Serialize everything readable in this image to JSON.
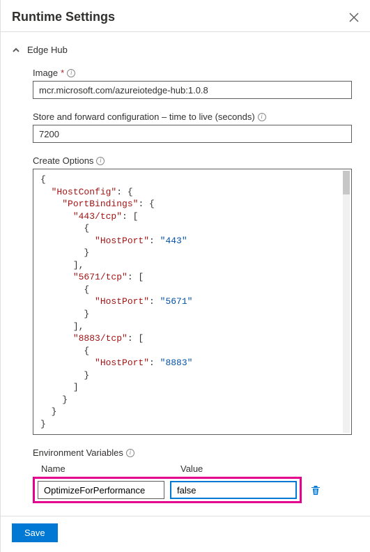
{
  "header": {
    "title": "Runtime Settings"
  },
  "section": {
    "title": "Edge Hub"
  },
  "image": {
    "label": "Image",
    "required": "*",
    "value": "mcr.microsoft.com/azureiotedge-hub:1.0.8"
  },
  "ttl": {
    "label": "Store and forward configuration – time to live (seconds)",
    "value": "7200"
  },
  "createOptions": {
    "label": "Create Options",
    "json": {
      "hostConfigKey": "\"HostConfig\"",
      "portBindingsKey": "\"PortBindings\"",
      "port443Key": "\"443/tcp\"",
      "port5671Key": "\"5671/tcp\"",
      "port8883Key": "\"8883/tcp\"",
      "hostPortKey": "\"HostPort\"",
      "val443": "\"443\"",
      "val5671": "\"5671\"",
      "val8883": "\"8883\""
    }
  },
  "envVars": {
    "label": "Environment Variables",
    "colName": "Name",
    "colValue": "Value",
    "rows": [
      {
        "name": "OptimizeForPerformance",
        "value": "false"
      }
    ]
  },
  "footer": {
    "save": "Save"
  }
}
